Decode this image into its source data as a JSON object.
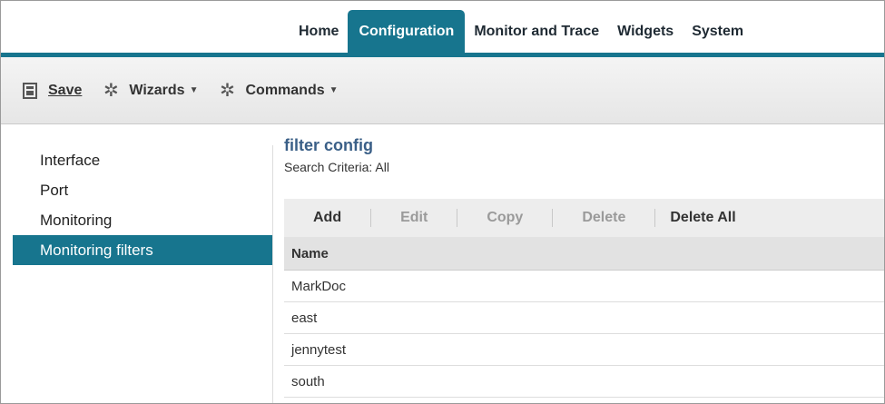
{
  "nav": {
    "tabs": [
      {
        "label": "Home",
        "active": false
      },
      {
        "label": "Configuration",
        "active": true
      },
      {
        "label": "Monitor and Trace",
        "active": false
      },
      {
        "label": "Widgets",
        "active": false
      },
      {
        "label": "System",
        "active": false
      }
    ]
  },
  "toolbar": {
    "save": {
      "icon": "save-icon",
      "label": "Save"
    },
    "wizards": {
      "icon": "gear-icon",
      "label": "Wizards"
    },
    "commands": {
      "icon": "gear-icon",
      "label": "Commands"
    }
  },
  "sidebar": {
    "items": [
      {
        "label": "Interface",
        "active": false
      },
      {
        "label": "Port",
        "active": false
      },
      {
        "label": "Monitoring",
        "active": false
      },
      {
        "label": "Monitoring filters",
        "active": true
      }
    ]
  },
  "main": {
    "title": "filter config",
    "search_criteria": "Search Criteria: All",
    "actions": [
      {
        "label": "Add",
        "enabled": true
      },
      {
        "label": "Edit",
        "enabled": false
      },
      {
        "label": "Copy",
        "enabled": false
      },
      {
        "label": "Delete",
        "enabled": false
      },
      {
        "label": "Delete All",
        "enabled": true
      }
    ],
    "table": {
      "columns": [
        "Name"
      ],
      "rows": [
        "MarkDoc",
        "east",
        "jennytest",
        "south"
      ]
    }
  },
  "colors": {
    "accent": "#17758e",
    "title": "#3a5f87",
    "disabled_text": "#9a9a9a"
  }
}
